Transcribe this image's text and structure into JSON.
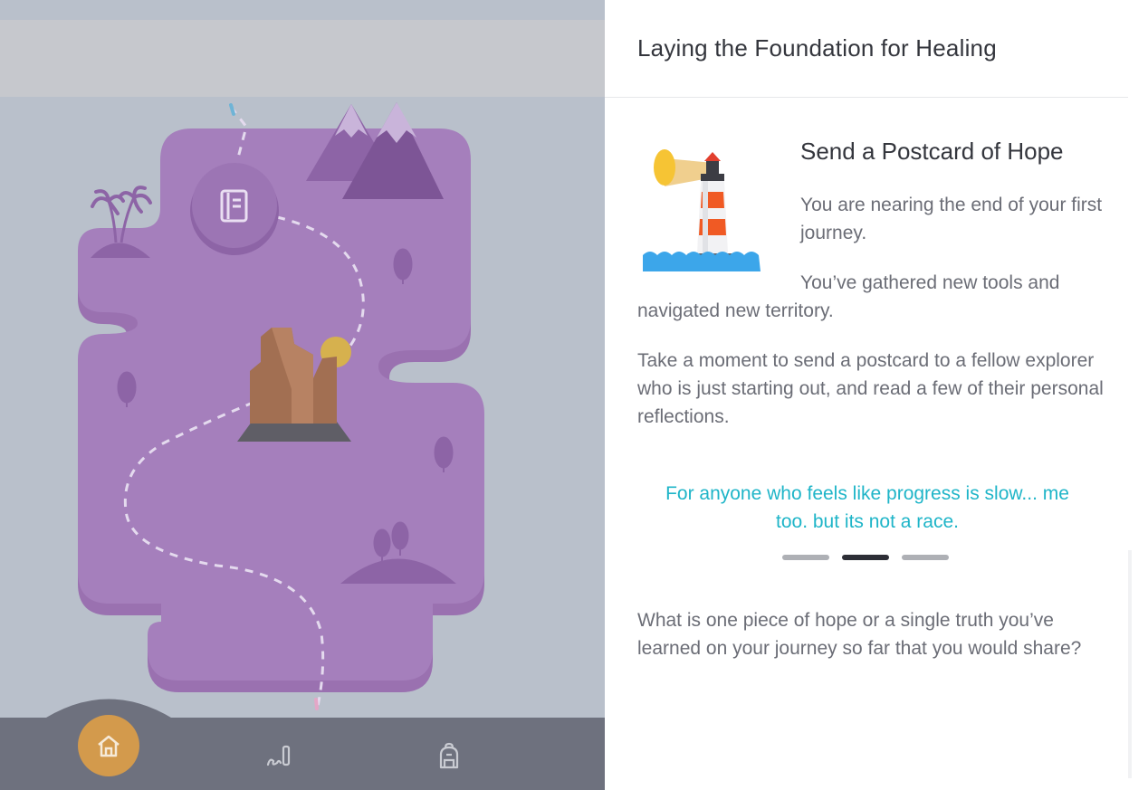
{
  "detail": {
    "title": "Laying the Foundation for Healing",
    "card_title": "Send a Postcard of Hope",
    "paragraphs": [
      "You are nearing the end of your first journey.",
      "You’ve gathered new tools and navigated new territory.",
      "Take a moment to send a postcard to a fellow explorer who is just starting out, and read a few of their personal reflections."
    ],
    "quote": "For anyone who feels like progress is slow... me too. but its not a race.",
    "carousel": {
      "count": 3,
      "active": 1
    },
    "question": "What is one piece of hope or a single truth you’ve learned on your journey so far that you would share?"
  },
  "nav": {
    "items": [
      {
        "name": "home",
        "icon": "home-icon",
        "active": true
      },
      {
        "name": "journal",
        "icon": "journal-pen-icon",
        "active": false
      },
      {
        "name": "backpack",
        "icon": "backpack-icon",
        "active": false
      }
    ]
  },
  "map": {
    "node_icon": "book-icon",
    "landmark": "rock-tower-icon"
  },
  "colors": {
    "map_island": "#a57fbc",
    "map_island_shadow": "#9a71b0",
    "accent_quote": "#1fb5c8",
    "nav_active": "#d39a4c",
    "nav_bg": "#6e717e"
  }
}
